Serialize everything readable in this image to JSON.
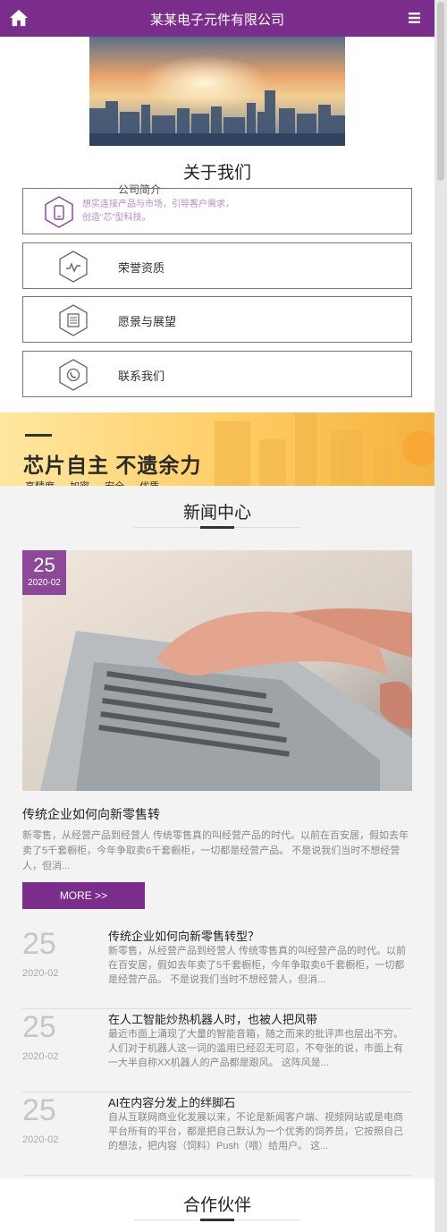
{
  "header": {
    "title": "某某电子元件有限公司",
    "home_icon": "home-icon",
    "menu_icon": "hamburger-menu-icon"
  },
  "about": {
    "title": "关于我们",
    "items": [
      {
        "label": "公司简介",
        "desc": "想实连接产品与市场，引导客户需求，创造“芯”型科技。",
        "icon": "phone-icon"
      },
      {
        "label": "荣誉资质",
        "icon": "pulse-icon"
      },
      {
        "label": "愿景与展望",
        "icon": "document-icon"
      },
      {
        "label": "联系我们",
        "icon": "contact-icon"
      }
    ]
  },
  "banner": {
    "slogan": "芯片自主 不遗余力",
    "sub": "高精度 加密 安全 优质"
  },
  "news": {
    "title": "新闻中心",
    "featured": {
      "day": "25",
      "month": "2020-02",
      "title": "传统企业如何向新零售转",
      "desc": "新零售，从经营产品到经营人 传统零售真的叫经营产品的时代。以前在百安居，假如去年卖了5千套橱柜，今年争取卖6千套橱柜，一切都是经营产品。 不是说我们当时不想经营人，但消...",
      "more": "MORE >>"
    },
    "list": [
      {
        "day": "25",
        "month": "2020-02",
        "title": "传统企业如何向新零售转型？",
        "summary": "新零售，从经营产品到经营人 传统零售真的叫经营产品的时代。以前在百安居，假如去年卖了5千套橱柜，今年争取卖6千套橱柜，一切都是经营产品。 不是说我们当时不想经营人，但消..."
      },
      {
        "day": "25",
        "month": "2020-02",
        "title": "在人工智能炒热机器人时，也被人把风带",
        "summary": "最近市面上涌现了大量的智能音箱，随之而来的批评声也层出不穷。人们对于机器人这一词的滥用已经忍无可忍，不夸张的说，市面上有一大半自称XX机器人的产品都是跟风。 这阵风是..."
      },
      {
        "day": "25",
        "month": "2020-02",
        "title": "AI在内容分发上的绊脚石",
        "summary": "自从互联网商业化发展以来，不论是新闻客户端、视频网站或是电商平台所有的平台，都是把自己默认为一个优秀的饲养员，它按照自己的想法，把内容（饲料）Push（喂）给用户。 这..."
      }
    ]
  },
  "partners": {
    "title": "合作伙伴"
  },
  "colors": {
    "brand": "#7b2d8b",
    "accent_banner": "#ffd36e"
  }
}
